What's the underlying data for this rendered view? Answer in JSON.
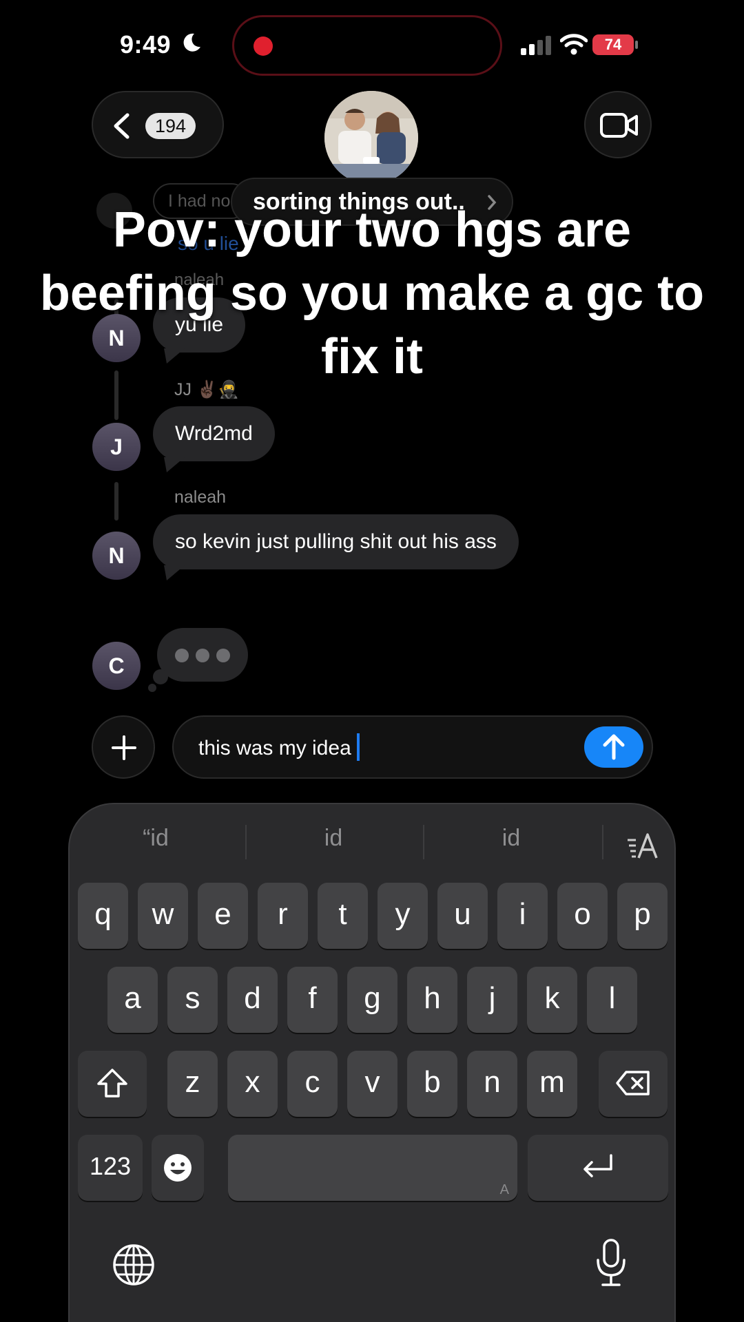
{
  "status_bar": {
    "time": "9:49",
    "battery": "74"
  },
  "header": {
    "back_count": "194",
    "group_name": "sorting things out..",
    "icons": {
      "back": "chevron-left-icon",
      "video": "video-camera-icon",
      "group_name": "chevron-right-icon"
    }
  },
  "faded": {
    "partial_bubble": "I had no",
    "partial_link": "so u lie",
    "partial_sender": "naleah"
  },
  "messages": [
    {
      "avatar": "N",
      "sender": "",
      "text": "yu lie"
    },
    {
      "avatar": "J",
      "sender": "JJ ✌🏿🥷",
      "text": "Wrd2md"
    },
    {
      "avatar": "N",
      "sender": "naleah",
      "text": "so kevin just pulling shit out his ass"
    },
    {
      "avatar": "C",
      "typing": true
    }
  ],
  "caption": "Pov: your two hgs are beefing so you make a gc to fix it",
  "composer": {
    "text": "this was my idea",
    "accent": "#1786f8"
  },
  "keyboard": {
    "suggestions": [
      "“id",
      "id",
      "id"
    ],
    "rows": [
      [
        "q",
        "w",
        "e",
        "r",
        "t",
        "y",
        "u",
        "i",
        "o",
        "p"
      ],
      [
        "a",
        "s",
        "d",
        "f",
        "g",
        "h",
        "j",
        "k",
        "l"
      ],
      [
        "z",
        "x",
        "c",
        "v",
        "b",
        "n",
        "m"
      ]
    ],
    "numbers_key": "123",
    "space_hint": "A"
  }
}
